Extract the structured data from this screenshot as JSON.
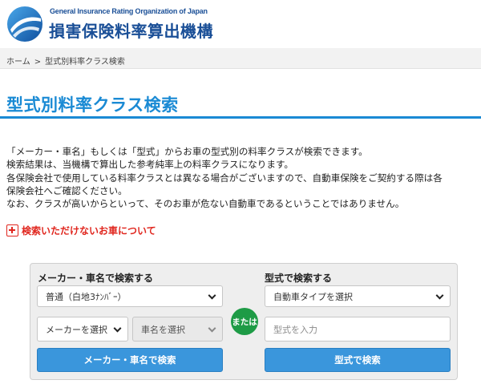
{
  "header": {
    "org_en": "General Insurance Rating Organization of Japan",
    "org_ja": "損害保険料率算出機構",
    "brand_color": "#1a4f97"
  },
  "breadcrumb": {
    "home": "ホーム",
    "separator": ">",
    "current": "型式別料率クラス検索"
  },
  "page": {
    "title": "型式別料率クラス検索",
    "accent_color": "#1a8ad4"
  },
  "description": [
    "「メーカー・車名」もしくは「型式」からお車の型式別の料率クラスが検索できます。",
    "検索結果は、当機構で算出した参考純率上の料率クラスになります。",
    "各保険会社で使用している料率クラスとは異なる場合がございますので、自動車保険をご契約する際は各",
    "保険会社へご確認ください。",
    "なお、クラスが高いからといって、そのお車が危ない自動車であるということではありません。"
  ],
  "notice": {
    "label": "検索いただけないお車について",
    "icon": "plus-icon",
    "color": "#e0261e"
  },
  "search": {
    "maker": {
      "heading": "メーカー・車名で検索する",
      "vehicle_class": "普通（白地3ﾅﾝﾊﾞｰ）",
      "maker_select": "メーカーを選択",
      "car_select": "車名を選択",
      "button": "メーカー・車名で検索"
    },
    "or_label": "または",
    "model": {
      "heading": "型式で検索する",
      "type_select": "自動車タイプを選択",
      "model_placeholder": "型式を入力",
      "button": "型式で検索"
    },
    "button_color": "#3a96dc",
    "or_color": "#1e9b46"
  }
}
